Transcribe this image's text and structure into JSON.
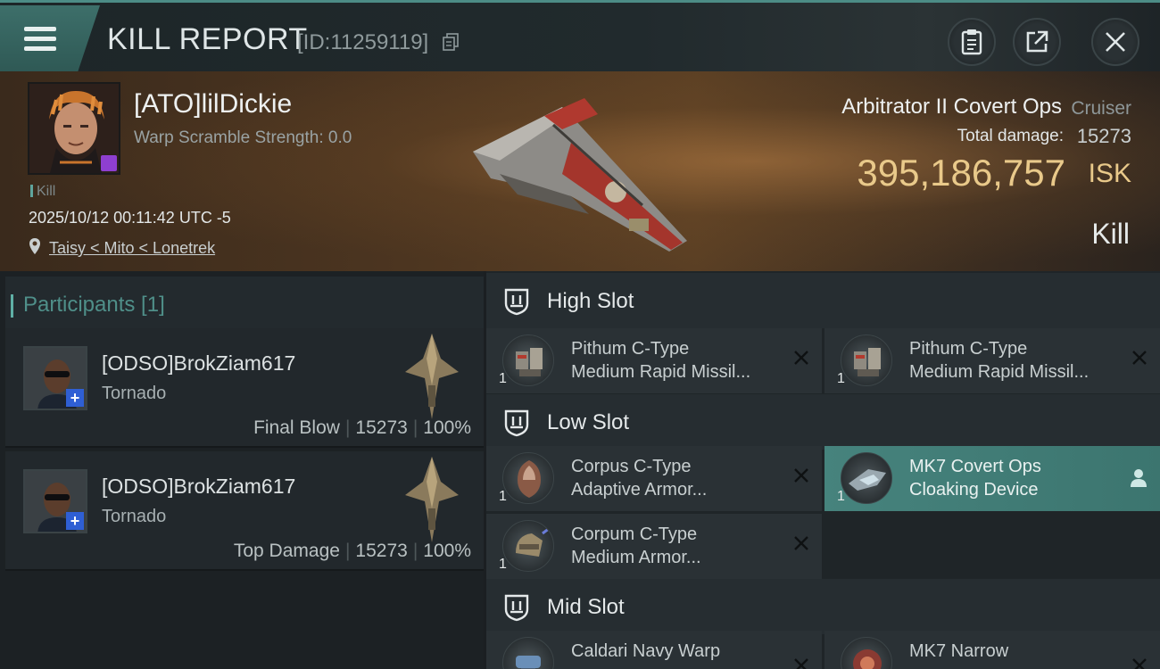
{
  "header": {
    "title": "KILL REPORT",
    "report_id": "[ID:11259119]"
  },
  "victim": {
    "name": "[ATO]lilDickie",
    "warp_scramble": "Warp Scramble Strength: 0.0",
    "kill_tag": "Kill",
    "datetime": "2025/10/12 00:11:42 UTC -5",
    "location": "Taisy < Mito < Lonetrek",
    "ship_name": "Arbitrator II Covert Ops",
    "ship_class": "Cruiser",
    "total_damage_label": "Total damage:",
    "total_damage": "15273",
    "isk_value": "395,186,757",
    "isk_unit": "ISK",
    "result": "Kill"
  },
  "participants": {
    "title": "Participants [1]",
    "rows": [
      {
        "name": "[ODSO]BrokZiam617",
        "ship": "Tornado",
        "role": "Final Blow",
        "damage": "15273",
        "percent": "100%"
      },
      {
        "name": "[ODSO]BrokZiam617",
        "ship": "Tornado",
        "role": "Top Damage",
        "damage": "15273",
        "percent": "100%"
      }
    ]
  },
  "fitting": {
    "high_slot": "High Slot",
    "low_slot": "Low Slot",
    "mid_slot": "Mid Slot",
    "high": [
      {
        "line1": "Pithum C-Type",
        "line2": "Medium Rapid Missil...",
        "qty": "1"
      },
      {
        "line1": "Pithum C-Type",
        "line2": "Medium Rapid Missil...",
        "qty": "1"
      }
    ],
    "low": [
      {
        "line1": "Corpus C-Type",
        "line2": "Adaptive Armor...",
        "qty": "1"
      },
      {
        "line1": "MK7 Covert Ops",
        "line2": "Cloaking Device",
        "qty": "1"
      },
      {
        "line1": "Corpum C-Type",
        "line2": "Medium Armor...",
        "qty": "1"
      }
    ],
    "mid": [
      {
        "line1": "Caldari Navy Warp",
        "line2": "",
        "qty": ""
      },
      {
        "line1": "MK7 Narrow",
        "line2": "",
        "qty": ""
      }
    ]
  },
  "colors": {
    "accent": "#4c8c86",
    "isk": "#e9c98a",
    "active_module": "#46837d"
  }
}
